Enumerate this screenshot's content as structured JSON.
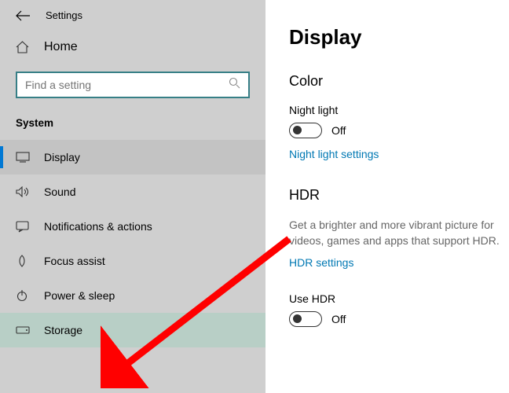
{
  "header": {
    "title": "Settings"
  },
  "sidebar": {
    "home_label": "Home",
    "search_placeholder": "Find a setting",
    "category": "System",
    "items": [
      {
        "icon": "display",
        "label": "Display",
        "selected": true
      },
      {
        "icon": "sound",
        "label": "Sound"
      },
      {
        "icon": "notifications",
        "label": "Notifications & actions"
      },
      {
        "icon": "focus",
        "label": "Focus assist"
      },
      {
        "icon": "power",
        "label": "Power & sleep"
      },
      {
        "icon": "storage",
        "label": "Storage",
        "highlight": true
      }
    ]
  },
  "content": {
    "title": "Display",
    "color": {
      "section": "Color",
      "night_light_label": "Night light",
      "night_light_state": "Off",
      "link": "Night light settings"
    },
    "hdr": {
      "section": "HDR",
      "description": "Get a brighter and more vibrant picture for videos, games and apps that support HDR.",
      "link": "HDR settings",
      "use_hdr_label": "Use HDR",
      "use_hdr_state": "Off"
    }
  }
}
